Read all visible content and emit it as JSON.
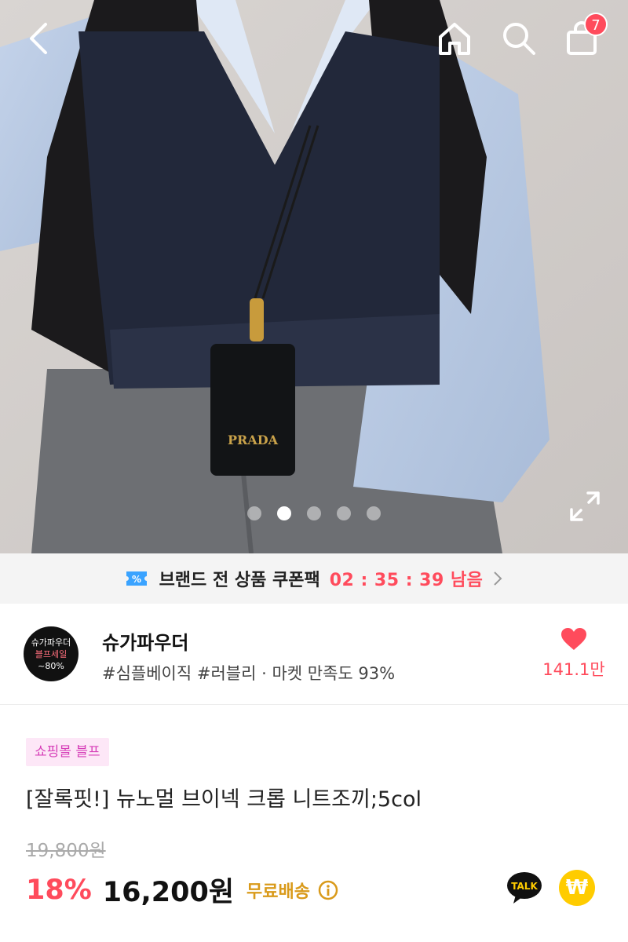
{
  "header": {
    "back_icon": "back-arrow-icon",
    "home_icon": "home-icon",
    "search_icon": "search-icon",
    "cart_icon": "shopping-bag-icon",
    "cart_count": "7"
  },
  "gallery": {
    "photo_icon": "product-photo",
    "photo_text": "PRADA",
    "total_images": 5,
    "active_index": 1,
    "expand_icon": "expand-icon"
  },
  "coupon": {
    "icon": "coupon-ticket-icon",
    "text": "브랜드 전 상품 쿠폰팩",
    "timer": "02 : 35 : 39 남음",
    "chevron_icon": "chevron-right-icon"
  },
  "shop": {
    "logo_line1": "슈가파우더",
    "logo_line2": "블프세일",
    "logo_line3": "~80%",
    "name": "슈가파우더",
    "tags": "#심플베이직 #러블리 · 마켓 만족도 93%",
    "like_icon": "heart-icon",
    "like_count": "141.1만"
  },
  "product": {
    "badge": "쇼핑몰 블프",
    "title": "[잘록핏!] 뉴노멀 브이넥 크롭 니트조끼;5col",
    "original_price": "19,800원",
    "discount": "18%",
    "price": "16,200원",
    "shipping": "무료배송",
    "info_icon": "info-icon",
    "talk_icon": "kakao-talk-icon",
    "talk_label": "TALK",
    "pay_icon": "won-pay-icon",
    "pay_label": "₩"
  },
  "colors": {
    "accent": "#ff4b5c",
    "shipping": "#d99a1a",
    "badge_bg": "#fde7f7",
    "badge_text": "#d63fb8"
  }
}
